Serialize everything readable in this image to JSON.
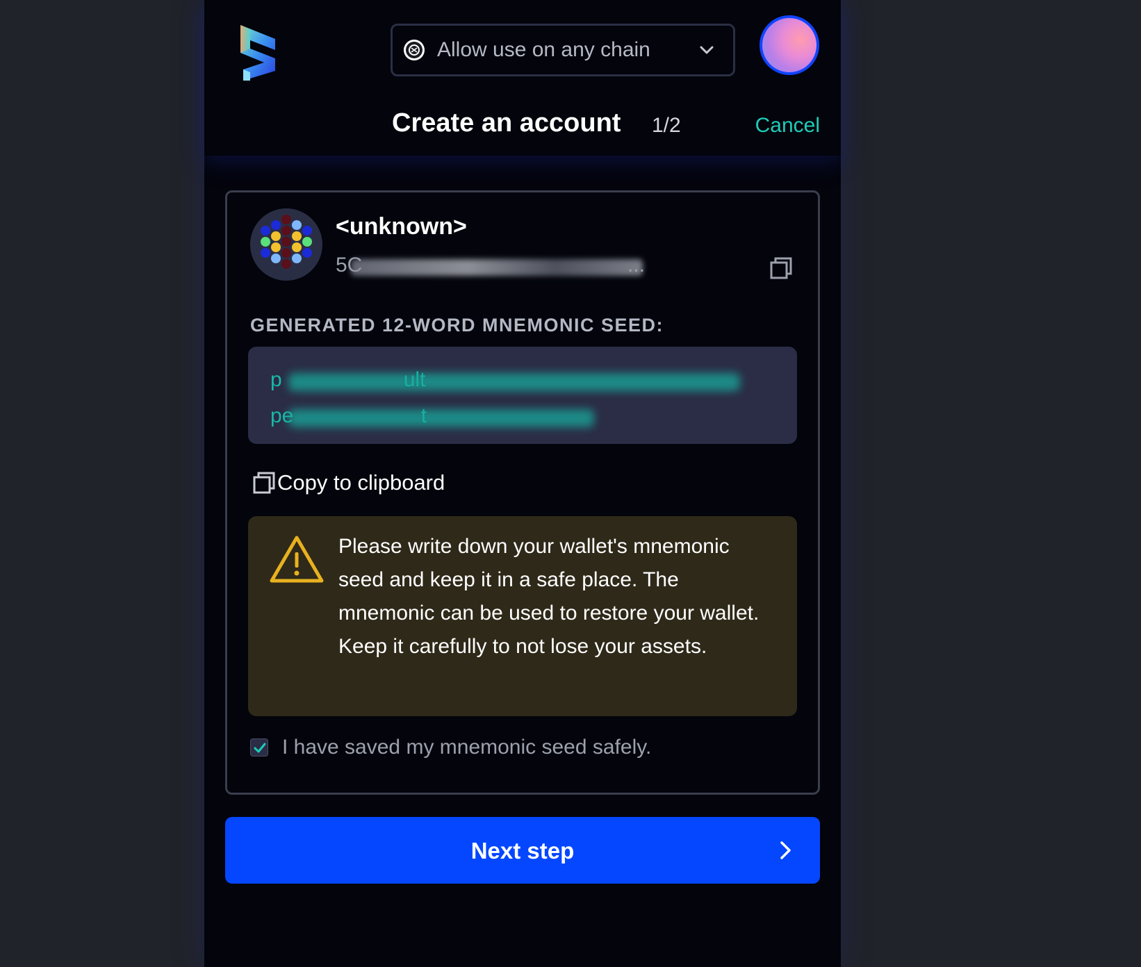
{
  "header": {
    "chain_select_label": "Allow use on any chain",
    "title": "Create an account",
    "step": "1/2",
    "cancel_label": "Cancel"
  },
  "account": {
    "name": "<unknown>",
    "address_prefix": "5C",
    "address_suffix": "..."
  },
  "seed": {
    "heading": "GENERATED 12-WORD MNEMONIC SEED:",
    "line1_visible": "p                     ult",
    "line2_visible": "pe                      t"
  },
  "copy_label": "Copy to clipboard",
  "warning_text": "Please write down your wallet's mnemonic seed and keep it in a safe place. The mnemonic can be used to restore your wallet. Keep it carefully to not lose your assets.",
  "checkbox": {
    "label": "I have saved my mnemonic seed safely.",
    "checked": true
  },
  "next_button_label": "Next step",
  "colors": {
    "accent": "#0547ff",
    "teal": "#1ecdb8",
    "warning_bg": "#2f2919"
  }
}
